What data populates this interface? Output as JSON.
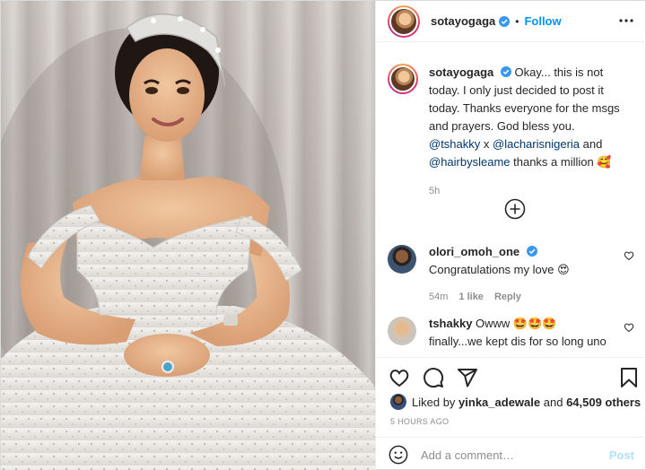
{
  "post": {
    "author": "sotayogaga",
    "follow_label": "Follow",
    "separator": "•",
    "more_icon": "more-horizontal-icon",
    "verified_icon": "verified-badge-icon"
  },
  "caption": {
    "user": "sotayogaga",
    "text_1": "Okay... this is not today. I only just decided to post it today. Thanks everyone for the msgs and prayers. God bless you. ",
    "mention_1": "@tshakky",
    "x": " x ",
    "mention_2": "@lacharisnigeria",
    "and": " and ",
    "mention_3": "@hairbysleame",
    "text_2": " thanks a million 🥰",
    "time": "5h"
  },
  "comments": [
    {
      "user": "olori_omoh_one",
      "text": "Congratulations my love 😍",
      "time": "54m",
      "likes": "1 like",
      "reply": "Reply"
    },
    {
      "user": "tshakky",
      "text": "Owww 🤩🤩🤩 finally...we kept dis for so long uno 🙌🙌🙌🙌🙌 congratulations 🙏🙏🙏"
    }
  ],
  "load_more_icon": "plus-circle-icon",
  "actions": {
    "icons": [
      "heart-icon",
      "comment-icon",
      "share-icon",
      "bookmark-icon"
    ],
    "liked_by_prefix": "Liked by ",
    "liked_by_user": "yinka_adewale",
    "and": " and ",
    "others": "64,509 others",
    "timestamp": "5 HOURS AGO"
  },
  "add_comment": {
    "placeholder": "Add a comment…",
    "post_label": "Post",
    "emoji_icon": "smiley-icon"
  },
  "colors": {
    "accent": "#0095f6",
    "post_disabled": "#b2dffc",
    "mention": "#00376b",
    "muted": "#8e8e8e"
  }
}
